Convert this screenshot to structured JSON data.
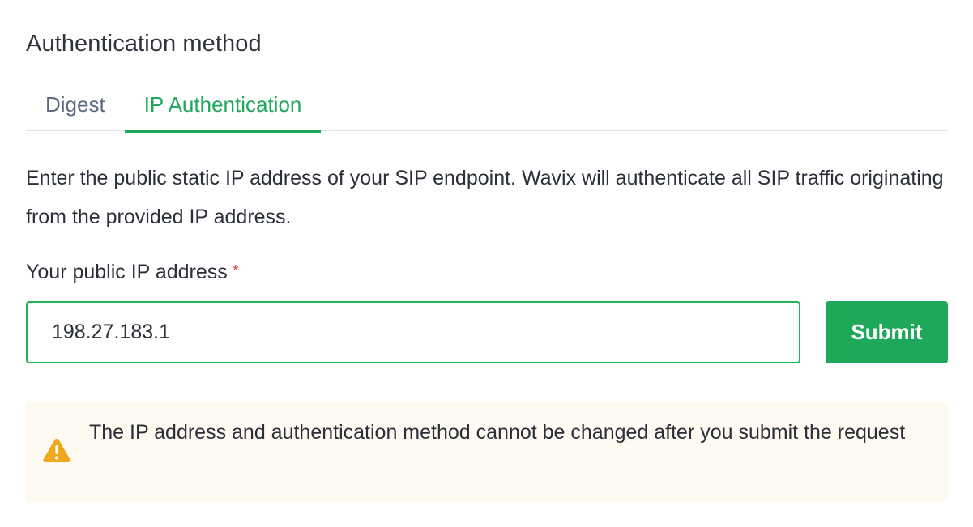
{
  "section": {
    "title": "Authentication method"
  },
  "tabs": [
    {
      "label": "Digest",
      "active": false
    },
    {
      "label": "IP Authentication",
      "active": true
    }
  ],
  "description": "Enter the public static IP address of your SIP endpoint. Wavix will authenticate all SIP traffic originating from the provided IP address.",
  "ip_field": {
    "label": "Your public IP address",
    "required_mark": "*",
    "value": "198.27.183.1"
  },
  "submit": {
    "label": "Submit"
  },
  "warning": {
    "icon": "warning-icon",
    "text": "The IP address and authentication method cannot be changed after you submit the request"
  },
  "colors": {
    "accent": "#1ea85a",
    "tab_inactive": "#5d6b82",
    "required": "#e5484d",
    "warning_icon": "#f0a81c",
    "warning_bg": "#fffaf1"
  }
}
